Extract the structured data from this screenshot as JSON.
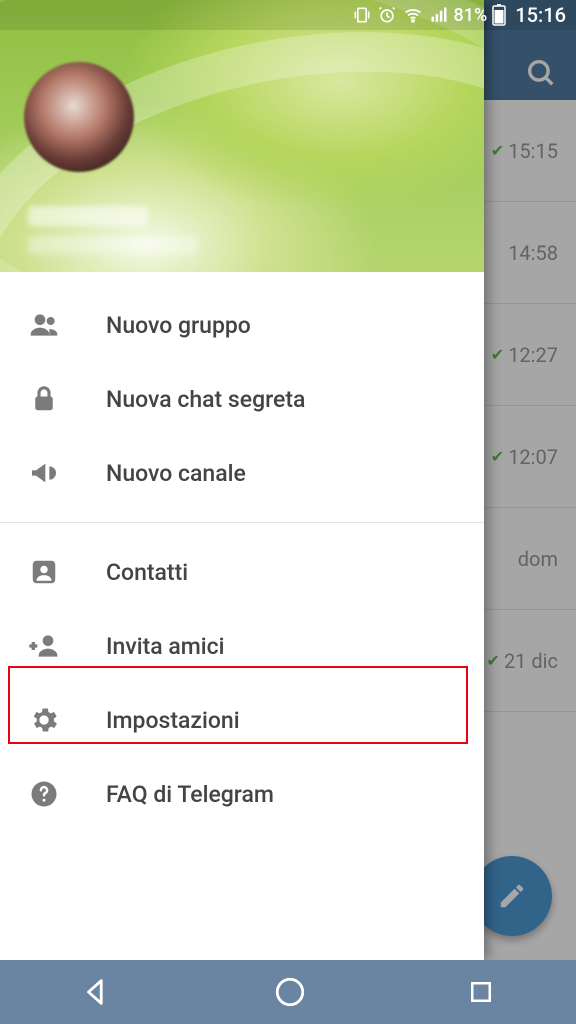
{
  "status": {
    "battery_pct": "81%",
    "time": "15:16"
  },
  "chats": [
    {
      "time": "15:15",
      "tick": true
    },
    {
      "time": "14:58",
      "tick": false
    },
    {
      "time": "12:27",
      "tick": true
    },
    {
      "time": "12:07",
      "tick": true
    },
    {
      "time": "dom",
      "tick": false
    },
    {
      "time": "21 dic",
      "tick": true
    }
  ],
  "drawer": {
    "items_a": [
      {
        "key": "new-group",
        "label": "Nuovo gruppo"
      },
      {
        "key": "secret-chat",
        "label": "Nuova chat segreta"
      },
      {
        "key": "new-channel",
        "label": "Nuovo canale"
      }
    ],
    "items_b": [
      {
        "key": "contacts",
        "label": "Contatti"
      },
      {
        "key": "invite",
        "label": "Invita amici"
      },
      {
        "key": "settings",
        "label": "Impostazioni"
      },
      {
        "key": "faq",
        "label": "FAQ di Telegram"
      }
    ]
  },
  "highlight": {
    "item_key": "settings"
  }
}
